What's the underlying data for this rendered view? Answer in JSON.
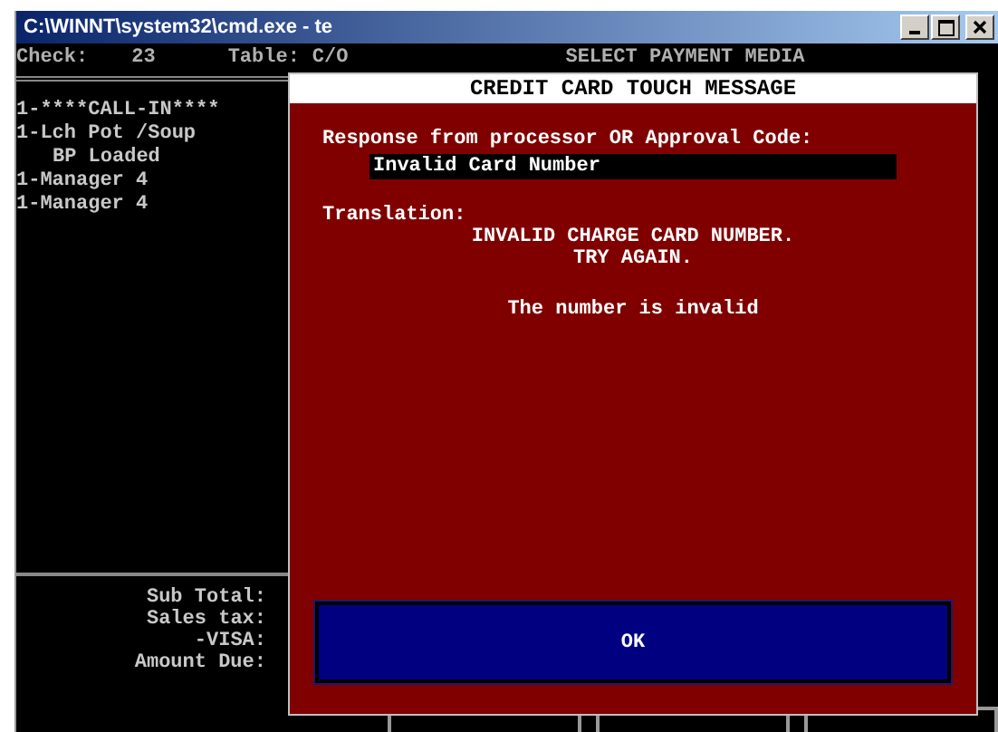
{
  "window": {
    "title": "C:\\WINNT\\system32\\cmd.exe - te"
  },
  "header": {
    "check_label": "Check:",
    "check_value": "23",
    "table_label": "Table:",
    "table_value": "C/O",
    "mode": "SELECT PAYMENT MEDIA"
  },
  "order_items": [
    {
      "text": "1-****CALL-IN****",
      "indented": false
    },
    {
      "text": "1-Lch Pot /Soup",
      "indented": false
    },
    {
      "text": "BP Loaded",
      "indented": true
    },
    {
      "text": "1-Manager 4",
      "indented": false
    },
    {
      "text": "1-Manager 4",
      "indented": false
    }
  ],
  "totals": [
    "Sub Total:",
    "Sales tax:",
    "-VISA:",
    "Amount Due:"
  ],
  "dialog": {
    "title": "CREDIT CARD TOUCH MESSAGE",
    "response_label": "Response from processor OR Approval Code:",
    "response_value": "Invalid Card Number",
    "translation_label": "Translation:",
    "translation_lines": [
      "INVALID CHARGE CARD NUMBER.",
      "TRY AGAIN."
    ],
    "message": "The number is invalid",
    "button": "OK"
  }
}
